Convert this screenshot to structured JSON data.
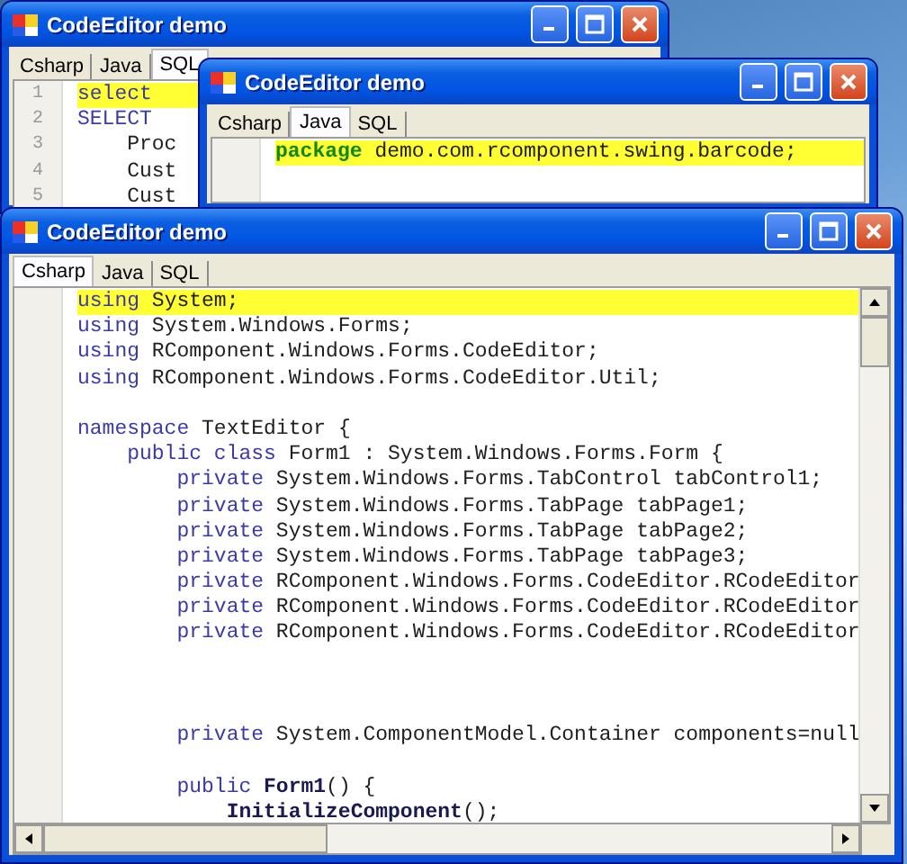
{
  "windows": [
    {
      "title": "CodeEditor demo",
      "scrollbars": false,
      "tabs": [
        {
          "label": "Csharp",
          "selected": false
        },
        {
          "label": "Java",
          "selected": false
        },
        {
          "label": "SQL",
          "selected": true
        }
      ],
      "line_numbers": [
        "1",
        "2",
        "3",
        "4",
        "5"
      ],
      "lines": [
        {
          "highlighted": true,
          "tokens": [
            {
              "kind": "keyword",
              "text": "select"
            }
          ]
        },
        {
          "highlighted": false,
          "tokens": [
            {
              "kind": "keyword",
              "text": "SELECT"
            }
          ]
        },
        {
          "highlighted": false,
          "tokens": [
            {
              "kind": "plain",
              "text": "    Proc"
            }
          ]
        },
        {
          "highlighted": false,
          "tokens": [
            {
              "kind": "plain",
              "text": "    Cust"
            }
          ]
        },
        {
          "highlighted": false,
          "tokens": [
            {
              "kind": "plain",
              "text": "    Cust"
            }
          ]
        }
      ]
    },
    {
      "title": "CodeEditor demo",
      "scrollbars": false,
      "tabs": [
        {
          "label": "Csharp",
          "selected": false
        },
        {
          "label": "Java",
          "selected": true
        },
        {
          "label": "SQL",
          "selected": false
        }
      ],
      "lines": [
        {
          "highlighted": true,
          "tokens": [
            {
              "kind": "java",
              "text": "package"
            },
            {
              "kind": "plain",
              "text": " demo.com.rcomponent.swing.barcode;"
            }
          ]
        }
      ]
    },
    {
      "title": "CodeEditor demo",
      "scrollbars": true,
      "tabs": [
        {
          "label": "Csharp",
          "selected": true
        },
        {
          "label": "Java",
          "selected": false
        },
        {
          "label": "SQL",
          "selected": false
        }
      ],
      "lines": [
        {
          "highlighted": true,
          "tokens": [
            {
              "kind": "keyword",
              "text": "using"
            },
            {
              "kind": "plain",
              "text": " System;"
            }
          ]
        },
        {
          "highlighted": false,
          "tokens": [
            {
              "kind": "keyword",
              "text": "using"
            },
            {
              "kind": "plain",
              "text": " System.Windows.Forms;"
            }
          ]
        },
        {
          "highlighted": false,
          "tokens": [
            {
              "kind": "keyword",
              "text": "using"
            },
            {
              "kind": "plain",
              "text": " RComponent.Windows.Forms.CodeEditor;"
            }
          ]
        },
        {
          "highlighted": false,
          "tokens": [
            {
              "kind": "keyword",
              "text": "using"
            },
            {
              "kind": "plain",
              "text": " RComponent.Windows.Forms.CodeEditor.Util;"
            }
          ]
        },
        {
          "highlighted": false
        },
        {
          "highlighted": false,
          "tokens": [
            {
              "kind": "keyword",
              "text": "namespace"
            },
            {
              "kind": "plain",
              "text": " TextEditor {"
            }
          ]
        },
        {
          "highlighted": false,
          "tokens": [
            {
              "kind": "keyword",
              "text": "    public class"
            },
            {
              "kind": "plain",
              "text": " Form1 : System.Windows.Forms.Form {"
            }
          ]
        },
        {
          "highlighted": false,
          "tokens": [
            {
              "kind": "keyword",
              "text": "        private"
            },
            {
              "kind": "plain",
              "text": " System.Windows.Forms.TabControl tabControl1;"
            }
          ]
        },
        {
          "highlighted": false,
          "tokens": [
            {
              "kind": "keyword",
              "text": "        private"
            },
            {
              "kind": "plain",
              "text": " System.Windows.Forms.TabPage tabPage1;"
            }
          ]
        },
        {
          "highlighted": false,
          "tokens": [
            {
              "kind": "keyword",
              "text": "        private"
            },
            {
              "kind": "plain",
              "text": " System.Windows.Forms.TabPage tabPage2;"
            }
          ]
        },
        {
          "highlighted": false,
          "tokens": [
            {
              "kind": "keyword",
              "text": "        private"
            },
            {
              "kind": "plain",
              "text": " System.Windows.Forms.TabPage tabPage3;"
            }
          ]
        },
        {
          "highlighted": false,
          "tokens": [
            {
              "kind": "keyword",
              "text": "        private"
            },
            {
              "kind": "plain",
              "text": " RComponent.Windows.Forms.CodeEditor.RCodeEditor"
            }
          ]
        },
        {
          "highlighted": false,
          "tokens": [
            {
              "kind": "keyword",
              "text": "        private"
            },
            {
              "kind": "plain",
              "text": " RComponent.Windows.Forms.CodeEditor.RCodeEditor"
            }
          ]
        },
        {
          "highlighted": false,
          "tokens": [
            {
              "kind": "keyword",
              "text": "        private"
            },
            {
              "kind": "plain",
              "text": " RComponent.Windows.Forms.CodeEditor.RCodeEditor"
            }
          ]
        },
        {
          "highlighted": false
        },
        {
          "highlighted": false
        },
        {
          "highlighted": false
        },
        {
          "highlighted": false,
          "tokens": [
            {
              "kind": "keyword",
              "text": "        private"
            },
            {
              "kind": "plain",
              "text": " System.ComponentModel.Container components=null"
            }
          ]
        },
        {
          "highlighted": false
        },
        {
          "highlighted": false,
          "tokens": [
            {
              "kind": "keyword",
              "text": "        public"
            },
            {
              "kind": "bold",
              "text": " Form1"
            },
            {
              "kind": "plain",
              "text": "() {"
            }
          ]
        },
        {
          "highlighted": false,
          "tokens": [
            {
              "kind": "bold",
              "text": "            InitializeComponent"
            },
            {
              "kind": "plain",
              "text": "();"
            }
          ]
        }
      ]
    }
  ]
}
